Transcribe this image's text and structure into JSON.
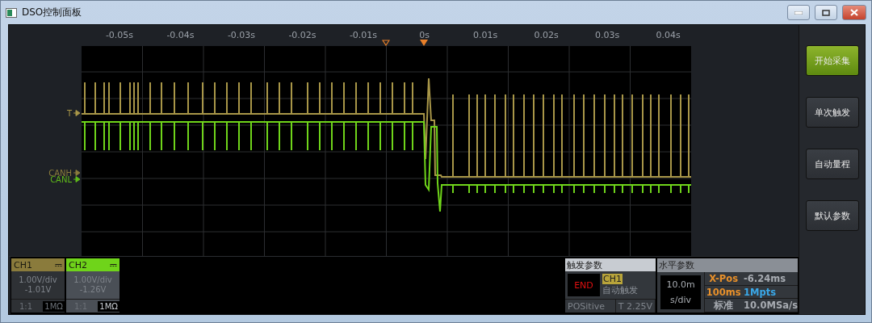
{
  "window": {
    "title": "DSO控制面板"
  },
  "time_axis": [
    "-0.05s",
    "-0.04s",
    "-0.03s",
    "-0.02s",
    "-0.01s",
    "0s",
    "0.01s",
    "0.02s",
    "0.03s",
    "0.04s"
  ],
  "level_markers": [
    {
      "label": "T",
      "color": "#a89648"
    },
    {
      "label": "CANH",
      "color": "#8a7b3c"
    },
    {
      "label": "CANL",
      "color": "#5fb81a"
    }
  ],
  "buttons": [
    {
      "label": "开始采集",
      "kind": "primary"
    },
    {
      "label": "单次触发",
      "kind": "normal"
    },
    {
      "label": "自动量程",
      "kind": "normal"
    },
    {
      "label": "默认参数",
      "kind": "normal"
    }
  ],
  "channels": [
    {
      "name": "CH1",
      "color": "#8a7b3c",
      "coupling": "⎓",
      "scale": "1.00V/div",
      "offset": "-1.01V",
      "probe": "1:1",
      "impedance": "1MΩ",
      "selected": false
    },
    {
      "name": "CH2",
      "color": "#6fd41a",
      "coupling": "⎓",
      "scale": "1.00V/div",
      "offset": "-1.26V",
      "probe": "1:1",
      "impedance": "1MΩ",
      "selected": true
    }
  ],
  "trigger": {
    "title": "触发参数",
    "status": "END",
    "source": "CH1",
    "mode": "自动触发",
    "slope": "POSitive",
    "level": "T 2.25V"
  },
  "horizontal": {
    "title": "水平参数",
    "timebase": "10.0m",
    "timebase_unit": "s/div",
    "rows": [
      {
        "label": {
          "text": "X-Pos",
          "color": "#e8902a"
        },
        "value": {
          "text": "-6.24ms",
          "color": "#a8acb2"
        }
      },
      {
        "label": {
          "text": "100ms",
          "color": "#e8902a"
        },
        "value": {
          "text": "1Mpts",
          "color": "#3aa8e8"
        }
      },
      {
        "label": {
          "text": "标准",
          "color": "#a8acb2"
        },
        "value": {
          "text": "10.0MSa/s"
        }
      }
    ]
  }
}
